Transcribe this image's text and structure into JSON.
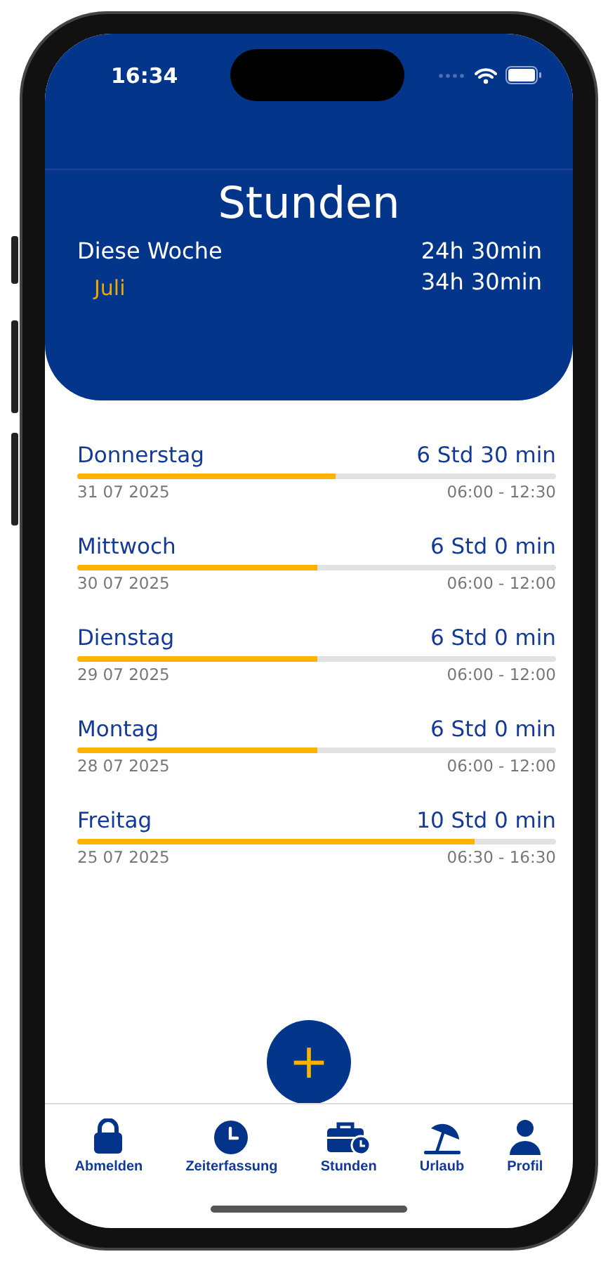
{
  "status_bar": {
    "time": "16:34"
  },
  "header": {
    "title": "Stunden",
    "summary": [
      {
        "label": "Diese Woche",
        "value": "24h 30min",
        "kind": "week"
      },
      {
        "label": "Juli",
        "value": "34h 30min",
        "kind": "month"
      }
    ]
  },
  "days": [
    {
      "day": "Donnerstag",
      "duration": "6 Std 30 min",
      "level": 0.54,
      "date": "31 07 2025",
      "range": "06:00 - 12:30"
    },
    {
      "day": "Mittwoch",
      "duration": "6 Std 0 min",
      "level": 0.5,
      "date": "30 07 2025",
      "range": "06:00 - 12:00"
    },
    {
      "day": "Dienstag",
      "duration": "6 Std 0 min",
      "level": 0.5,
      "date": "29 07 2025",
      "range": "06:00 - 12:00"
    },
    {
      "day": "Montag",
      "duration": "6 Std 0 min",
      "level": 0.5,
      "date": "28 07 2025",
      "range": "06:00 - 12:00"
    },
    {
      "day": "Freitag",
      "duration": "10 Std 0 min",
      "level": 0.83,
      "date": "25 07 2025",
      "range": "06:30 - 16:30"
    }
  ],
  "fab": {
    "label": "+"
  },
  "tab_bar": [
    {
      "label": "Abmelden",
      "kind": "lock"
    },
    {
      "label": "Zeiterfassung",
      "kind": "clock"
    },
    {
      "label": "Stunden",
      "kind": "briefcase"
    },
    {
      "label": "Urlaub",
      "kind": "beach"
    },
    {
      "label": "Profil",
      "kind": "person"
    }
  ]
}
